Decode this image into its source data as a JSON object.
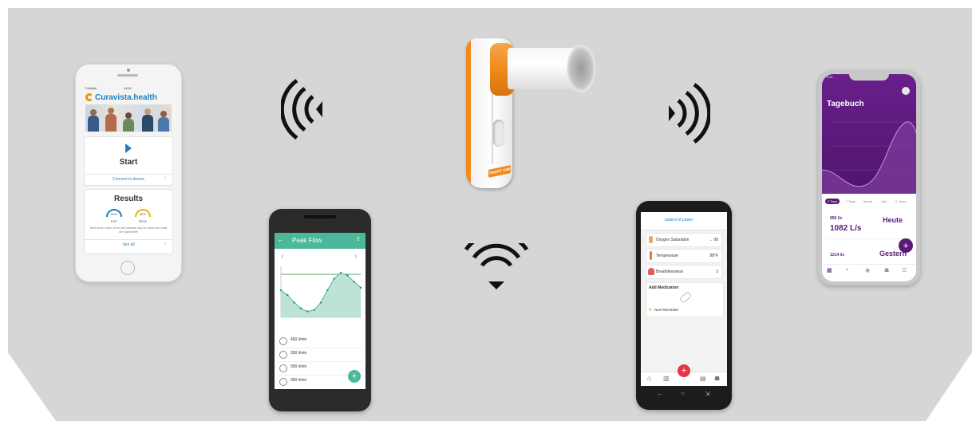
{
  "colors": {
    "background": "#d6d6d6",
    "curavista_orange": "#f39200",
    "curavista_blue": "#1a7fc4",
    "peak_flow_green": "#4cb89a",
    "tagebuch_purple": "#5a1a78",
    "accent_pink": "#e8334a",
    "device_orange": "#f08a1c"
  },
  "icons": {
    "left_signal": "wireless-signal-left-icon",
    "right_signal": "wireless-signal-right-icon",
    "bottom_signal": "wireless-signal-down-icon"
  },
  "device": {
    "brand_label": "SMART ONE"
  },
  "phone1": {
    "status_left": "T-Mobile",
    "status_time": "14:01",
    "logo_text": "Curavista.health",
    "start_title": "Start",
    "connect_label": "Connect to device",
    "results_title": "Results",
    "gauge1_value": "90%",
    "gauge1_label": "FVC",
    "gauge2_value": "82%",
    "gauge2_label": "FEV1",
    "results_caption": "Best blown value of the last calendar day on which you used the Spirometer",
    "see_all_label": "See all"
  },
  "phone2": {
    "title": "Peak Flow",
    "items": [
      {
        "value": "450 l/min"
      },
      {
        "value": "350 l/min"
      },
      {
        "value": "300 l/min"
      },
      {
        "value": "350 l/min"
      }
    ]
  },
  "phone3": {
    "logo_text": "patient M power",
    "rows": [
      {
        "label": "Oxygen Saturation",
        "value": "→ 99"
      },
      {
        "label": "Temperature",
        "value": "98°F"
      },
      {
        "label": "Breathlessness",
        "value": "2"
      }
    ],
    "add_medication": "Add Medication",
    "next_reminder": "Next Reminder:"
  },
  "phone4": {
    "time": "9:41",
    "title": "Tagebuch",
    "tabs": [
      "2 Tage",
      "7 Tage",
      "Monat",
      "Jahr",
      "2 Jahre"
    ],
    "entry1_small": "956 l/s",
    "entry1_big": "1082 L/s",
    "entry1_day": "Heute",
    "entry2_small": "1214 l/s",
    "entry2_day": "Gestern"
  },
  "chart_data": {
    "type": "area",
    "series": [
      {
        "values": [
          0.55,
          0.45,
          0.3,
          0.18,
          0.12,
          0.15,
          0.3,
          0.55,
          0.78,
          0.9,
          0.85,
          0.72,
          0.6
        ]
      }
    ]
  }
}
